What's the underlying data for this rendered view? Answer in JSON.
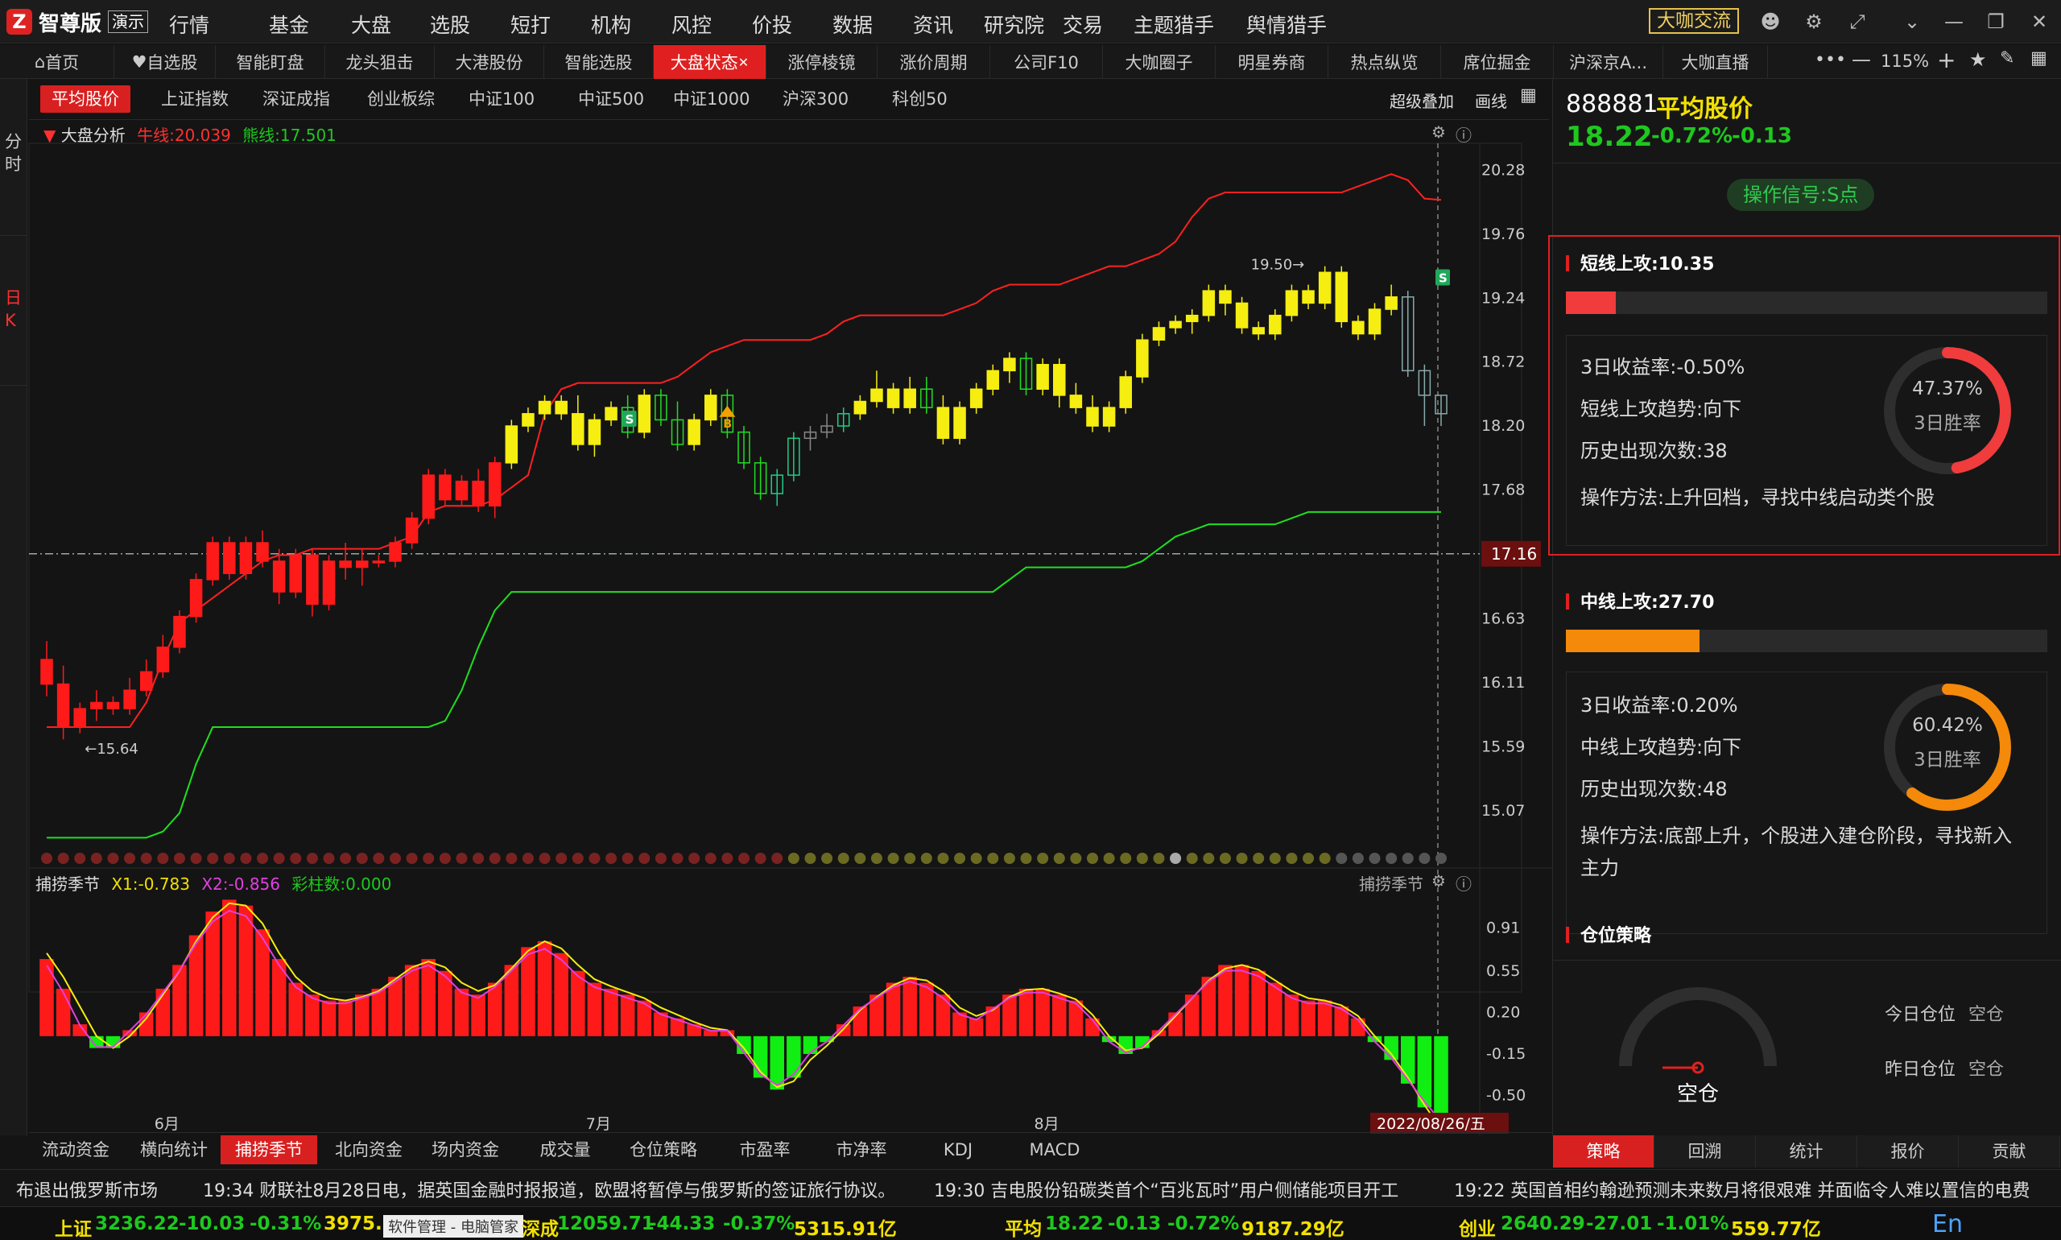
{
  "app": {
    "logo_mark": "Z",
    "name": "智尊版",
    "edition": "演示"
  },
  "menu": [
    "行情",
    "基金",
    "大盘",
    "选股",
    "短打",
    "机构",
    "风控",
    "价投",
    "数据",
    "资讯",
    "研究院",
    "交易",
    "主题猎手",
    "舆情猎手"
  ],
  "exchange_button": "大咖交流",
  "tabs": [
    "首页",
    "自选股",
    "智能盯盘",
    "龙头狙击",
    "大港股份",
    "智能选股",
    "大盘状态",
    "涨停棱镜",
    "涨价周期",
    "公司F10",
    "大咖圈子",
    "明星券商",
    "热点纵览",
    "席位掘金",
    "沪深京A...",
    "大咖直播"
  ],
  "zoom": "115%",
  "left_rail": [
    "分时",
    "日K"
  ],
  "index_tabs": [
    "平均股价",
    "上证指数",
    "深证成指",
    "创业板综",
    "中证100",
    "中证500",
    "中证1000",
    "沪深300",
    "科创50"
  ],
  "chart_tools": [
    "超级叠加",
    "画线"
  ],
  "main_legend": {
    "name": "大盘分析",
    "bull": "牛线:20.039",
    "bear": "熊线:17.501"
  },
  "sub_legend": {
    "name": "捕捞季节",
    "x1": "X1:-0.783",
    "x2": "X2:-0.856",
    "bars": "彩柱数:0.000",
    "right": "捕捞季节"
  },
  "price_axis": [
    "20.28",
    "19.76",
    "19.24",
    "18.72",
    "18.20",
    "17.68",
    "17.16",
    "16.63",
    "16.11",
    "15.59",
    "15.07"
  ],
  "sub_axis": [
    "0.91",
    "0.55",
    "0.20",
    "-0.15",
    "-0.50"
  ],
  "crosshair_price": "17.16",
  "date_axis": [
    "6月",
    "7月",
    "8月"
  ],
  "current_date": "2022/08/26/五",
  "annotations": {
    "low": "←15.64",
    "high": "19.50→",
    "s": "S",
    "b": "B"
  },
  "chart_data": {
    "type": "candlestick",
    "ylim": [
      14.8,
      20.5
    ],
    "categories": [
      "6月",
      "7月",
      "8月"
    ],
    "candles": [
      [
        16.3,
        16.45,
        16.0,
        16.1
      ],
      [
        16.1,
        16.25,
        15.65,
        15.75
      ],
      [
        15.75,
        15.95,
        15.7,
        15.9
      ],
      [
        15.9,
        16.05,
        15.8,
        15.95
      ],
      [
        15.95,
        16.0,
        15.85,
        15.9
      ],
      [
        15.9,
        16.15,
        15.85,
        16.05
      ],
      [
        16.05,
        16.3,
        16.0,
        16.2
      ],
      [
        16.2,
        16.5,
        16.15,
        16.4
      ],
      [
        16.4,
        16.7,
        16.35,
        16.65
      ],
      [
        16.65,
        17.0,
        16.6,
        16.95
      ],
      [
        16.95,
        17.3,
        16.9,
        17.25
      ],
      [
        17.25,
        17.3,
        16.95,
        17.0
      ],
      [
        17.0,
        17.3,
        16.95,
        17.25
      ],
      [
        17.25,
        17.35,
        17.05,
        17.1
      ],
      [
        17.1,
        17.2,
        16.75,
        16.85
      ],
      [
        16.85,
        17.2,
        16.8,
        17.15
      ],
      [
        17.15,
        17.2,
        16.65,
        16.75
      ],
      [
        16.75,
        17.15,
        16.7,
        17.1
      ],
      [
        17.1,
        17.25,
        16.95,
        17.05
      ],
      [
        17.05,
        17.2,
        16.9,
        17.1
      ],
      [
        17.1,
        17.15,
        17.05,
        17.1
      ],
      [
        17.1,
        17.3,
        17.05,
        17.25
      ],
      [
        17.25,
        17.5,
        17.2,
        17.45
      ],
      [
        17.45,
        17.85,
        17.4,
        17.8
      ],
      [
        17.8,
        17.85,
        17.55,
        17.6
      ],
      [
        17.6,
        17.8,
        17.55,
        17.75
      ],
      [
        17.75,
        17.85,
        17.5,
        17.55
      ],
      [
        17.55,
        17.95,
        17.45,
        17.9
      ],
      [
        17.9,
        18.25,
        17.85,
        18.2
      ],
      [
        18.2,
        18.35,
        18.15,
        18.3
      ],
      [
        18.3,
        18.45,
        18.25,
        18.4
      ],
      [
        18.4,
        18.45,
        18.25,
        18.3
      ],
      [
        18.3,
        18.45,
        18.0,
        18.05
      ],
      [
        18.05,
        18.3,
        17.95,
        18.25
      ],
      [
        18.25,
        18.4,
        18.2,
        18.35
      ],
      [
        18.35,
        18.45,
        18.1,
        18.15
      ],
      [
        18.15,
        18.5,
        18.1,
        18.45
      ],
      [
        18.45,
        18.5,
        18.2,
        18.25
      ],
      [
        18.25,
        18.4,
        18.0,
        18.05
      ],
      [
        18.05,
        18.3,
        18.0,
        18.25
      ],
      [
        18.25,
        18.5,
        18.2,
        18.45
      ],
      [
        18.45,
        18.5,
        18.1,
        18.15
      ],
      [
        18.15,
        18.2,
        17.85,
        17.9
      ],
      [
        17.9,
        17.95,
        17.6,
        17.65
      ],
      [
        17.65,
        17.85,
        17.55,
        17.8
      ],
      [
        17.8,
        18.15,
        17.75,
        18.1
      ],
      [
        18.1,
        18.2,
        18.0,
        18.15
      ],
      [
        18.15,
        18.3,
        18.1,
        18.2
      ],
      [
        18.2,
        18.35,
        18.15,
        18.3
      ],
      [
        18.3,
        18.45,
        18.25,
        18.4
      ],
      [
        18.4,
        18.65,
        18.35,
        18.5
      ],
      [
        18.5,
        18.55,
        18.3,
        18.35
      ],
      [
        18.35,
        18.6,
        18.3,
        18.5
      ],
      [
        18.5,
        18.6,
        18.3,
        18.35
      ],
      [
        18.35,
        18.45,
        18.05,
        18.1
      ],
      [
        18.1,
        18.4,
        18.05,
        18.35
      ],
      [
        18.35,
        18.55,
        18.3,
        18.5
      ],
      [
        18.5,
        18.7,
        18.45,
        18.65
      ],
      [
        18.65,
        18.8,
        18.55,
        18.75
      ],
      [
        18.75,
        18.8,
        18.45,
        18.5
      ],
      [
        18.5,
        18.75,
        18.45,
        18.7
      ],
      [
        18.7,
        18.75,
        18.35,
        18.45
      ],
      [
        18.45,
        18.55,
        18.3,
        18.35
      ],
      [
        18.35,
        18.45,
        18.15,
        18.2
      ],
      [
        18.2,
        18.4,
        18.15,
        18.35
      ],
      [
        18.35,
        18.65,
        18.3,
        18.6
      ],
      [
        18.6,
        18.95,
        18.55,
        18.9
      ],
      [
        18.9,
        19.05,
        18.85,
        19.0
      ],
      [
        19.0,
        19.1,
        18.95,
        19.05
      ],
      [
        19.05,
        19.15,
        18.95,
        19.1
      ],
      [
        19.1,
        19.35,
        19.05,
        19.3
      ],
      [
        19.3,
        19.35,
        19.1,
        19.2
      ],
      [
        19.2,
        19.25,
        18.95,
        19.0
      ],
      [
        19.0,
        19.05,
        18.9,
        18.95
      ],
      [
        18.95,
        19.15,
        18.9,
        19.1
      ],
      [
        19.1,
        19.35,
        19.05,
        19.3
      ],
      [
        19.3,
        19.35,
        19.15,
        19.2
      ],
      [
        19.2,
        19.5,
        19.15,
        19.45
      ],
      [
        19.45,
        19.5,
        19.0,
        19.05
      ],
      [
        19.05,
        19.1,
        18.9,
        18.95
      ],
      [
        18.95,
        19.2,
        18.9,
        19.15
      ],
      [
        19.15,
        19.35,
        19.1,
        19.25
      ],
      [
        19.25,
        19.3,
        18.6,
        18.65
      ],
      [
        18.65,
        18.7,
        18.2,
        18.45
      ],
      [
        18.45,
        18.45,
        18.2,
        18.3
      ]
    ],
    "bull_line": [
      15.75,
      15.75,
      15.75,
      15.75,
      15.75,
      15.75,
      15.95,
      16.3,
      16.6,
      16.7,
      16.8,
      16.9,
      17.0,
      17.1,
      17.15,
      17.15,
      17.2,
      17.2,
      17.2,
      17.2,
      17.2,
      17.25,
      17.3,
      17.5,
      17.55,
      17.55,
      17.55,
      17.6,
      17.7,
      17.8,
      18.3,
      18.5,
      18.55,
      18.55,
      18.55,
      18.55,
      18.55,
      18.55,
      18.6,
      18.7,
      18.8,
      18.85,
      18.9,
      18.9,
      18.9,
      18.9,
      18.9,
      18.95,
      19.05,
      19.1,
      19.1,
      19.1,
      19.1,
      19.1,
      19.1,
      19.15,
      19.2,
      19.3,
      19.35,
      19.35,
      19.35,
      19.35,
      19.4,
      19.45,
      19.5,
      19.5,
      19.55,
      19.6,
      19.7,
      19.9,
      20.05,
      20.1,
      20.1,
      20.1,
      20.1,
      20.1,
      20.1,
      20.1,
      20.1,
      20.15,
      20.2,
      20.25,
      20.2,
      20.05,
      20.04
    ],
    "bear_line": [
      14.85,
      14.85,
      14.85,
      14.85,
      14.85,
      14.85,
      14.85,
      14.9,
      15.05,
      15.45,
      15.75,
      15.75,
      15.75,
      15.75,
      15.75,
      15.75,
      15.75,
      15.75,
      15.75,
      15.75,
      15.75,
      15.75,
      15.75,
      15.75,
      15.8,
      16.05,
      16.4,
      16.7,
      16.85,
      16.85,
      16.85,
      16.85,
      16.85,
      16.85,
      16.85,
      16.85,
      16.85,
      16.85,
      16.85,
      16.85,
      16.85,
      16.85,
      16.85,
      16.85,
      16.85,
      16.85,
      16.85,
      16.85,
      16.85,
      16.85,
      16.85,
      16.85,
      16.85,
      16.85,
      16.85,
      16.85,
      16.85,
      16.85,
      16.95,
      17.05,
      17.05,
      17.05,
      17.05,
      17.05,
      17.05,
      17.05,
      17.1,
      17.2,
      17.3,
      17.35,
      17.4,
      17.4,
      17.4,
      17.4,
      17.4,
      17.45,
      17.5,
      17.5,
      17.5,
      17.5,
      17.5,
      17.5,
      17.5,
      17.5,
      17.5
    ],
    "sub_series": {
      "name": "捕捞季节",
      "ylim": [
        -0.7,
        1.2
      ],
      "bars": [
        0.65,
        0.4,
        0.1,
        -0.1,
        -0.1,
        0.05,
        0.2,
        0.4,
        0.6,
        0.85,
        1.05,
        1.15,
        1.1,
        0.9,
        0.65,
        0.45,
        0.35,
        0.3,
        0.3,
        0.35,
        0.4,
        0.5,
        0.6,
        0.65,
        0.55,
        0.4,
        0.35,
        0.45,
        0.6,
        0.75,
        0.8,
        0.7,
        0.55,
        0.45,
        0.4,
        0.35,
        0.3,
        0.2,
        0.15,
        0.1,
        0.05,
        0.05,
        -0.15,
        -0.35,
        -0.45,
        -0.35,
        -0.15,
        -0.05,
        0.1,
        0.25,
        0.35,
        0.45,
        0.5,
        0.45,
        0.35,
        0.2,
        0.15,
        0.25,
        0.35,
        0.4,
        0.4,
        0.35,
        0.3,
        0.15,
        -0.05,
        -0.15,
        -0.1,
        0.05,
        0.2,
        0.35,
        0.5,
        0.6,
        0.6,
        0.55,
        0.45,
        0.35,
        0.3,
        0.3,
        0.25,
        0.15,
        -0.05,
        -0.2,
        -0.4,
        -0.6,
        -0.78
      ],
      "x1": [
        0.7,
        0.5,
        0.25,
        0.0,
        -0.1,
        0.0,
        0.15,
        0.35,
        0.55,
        0.8,
        1.0,
        1.12,
        1.1,
        0.95,
        0.7,
        0.5,
        0.38,
        0.32,
        0.3,
        0.33,
        0.38,
        0.48,
        0.58,
        0.63,
        0.58,
        0.45,
        0.38,
        0.43,
        0.57,
        0.72,
        0.8,
        0.74,
        0.6,
        0.48,
        0.42,
        0.37,
        0.32,
        0.24,
        0.18,
        0.12,
        0.07,
        0.05,
        -0.1,
        -0.3,
        -0.43,
        -0.38,
        -0.2,
        -0.08,
        0.06,
        0.22,
        0.33,
        0.43,
        0.49,
        0.47,
        0.38,
        0.24,
        0.17,
        0.22,
        0.33,
        0.39,
        0.4,
        0.36,
        0.31,
        0.18,
        0.0,
        -0.12,
        -0.1,
        0.02,
        0.17,
        0.32,
        0.47,
        0.57,
        0.6,
        0.56,
        0.47,
        0.38,
        0.32,
        0.3,
        0.26,
        0.17,
        0.0,
        -0.15,
        -0.35,
        -0.58,
        -0.783
      ]
    }
  },
  "right_panel": {
    "code": "888881",
    "name": "平均股价",
    "price": "18.22",
    "pct": "-0.72%",
    "chg": "-0.13",
    "signal": "操作信号:S点",
    "short": {
      "title": "短线上攻:10.35",
      "bar_pct": 10.35,
      "ret_label": "3日收益率:",
      "ret": "-0.50%",
      "trend_label": "短线上攻趋势:",
      "trend": "向下",
      "count_label": "历史出现次数:",
      "count": "38",
      "method_label": "操作方法:",
      "method": "上升回档，寻找中线启动类个股",
      "win": "47.37%",
      "win_label": "3日胜率",
      "win_frac": 0.4737
    },
    "mid": {
      "title": "中线上攻:27.70",
      "bar_pct": 27.7,
      "ret_label": "3日收益率:",
      "ret": "0.20%",
      "trend_label": "中线上攻趋势:",
      "trend": "向下",
      "count_label": "历史出现次数:",
      "count": "48",
      "method_label": "操作方法:",
      "method": "底部上升，个股进入建仓阶段，寻找新入主力",
      "win": "60.42%",
      "win_label": "3日胜率",
      "win_frac": 0.6042
    },
    "position": {
      "title": "仓位策略",
      "gauge_label": "空仓",
      "today_label": "今日仓位",
      "today": "空仓",
      "yest_label": "昨日仓位",
      "yest": "空仓"
    },
    "tabs": [
      "策略",
      "回溯",
      "统计",
      "报价",
      "贡献"
    ]
  },
  "bottom_tabs": [
    "流动资金",
    "横向统计",
    "捕捞季节",
    "北向资金",
    "场内资金",
    "成交量",
    "仓位策略",
    "市盈率",
    "市净率",
    "KDJ",
    "MACD"
  ],
  "news": [
    "布退出俄罗斯市场",
    "19:34 财联社8月28日电，据英国金融时报报道，欧盟将暂停与俄罗斯的签证旅行协议。",
    "19:30 吉电股份铅碳类首个“百兆瓦时”用户侧储能项目开工",
    "19:22 英国首相约翰逊预测未来数月将很艰难 并面临令人难以置信的电费"
  ],
  "status": {
    "sh_label": "上证",
    "sh": "3236.22",
    "sh_chg": "-10.03",
    "sh_pct": "-0.31%",
    "sh_amt": "3975.5",
    "tooltip": "软件管理 - 电脑管家",
    "sz_label": "深成",
    "sz": "12059.71",
    "sz_chg": "-44.33",
    "sz_pct": "-0.37%",
    "sz_amt": "5315.91亿",
    "avg_label": "平均",
    "avg": "18.22",
    "avg_chg": "-0.13",
    "avg_pct": "-0.72%",
    "avg_amt": "9187.29亿",
    "cy_label": "创业",
    "cy": "2640.29",
    "cy_chg": "-27.01",
    "cy_pct": "-1.01%",
    "cy_amt": "559.77亿",
    "ime": "En"
  }
}
